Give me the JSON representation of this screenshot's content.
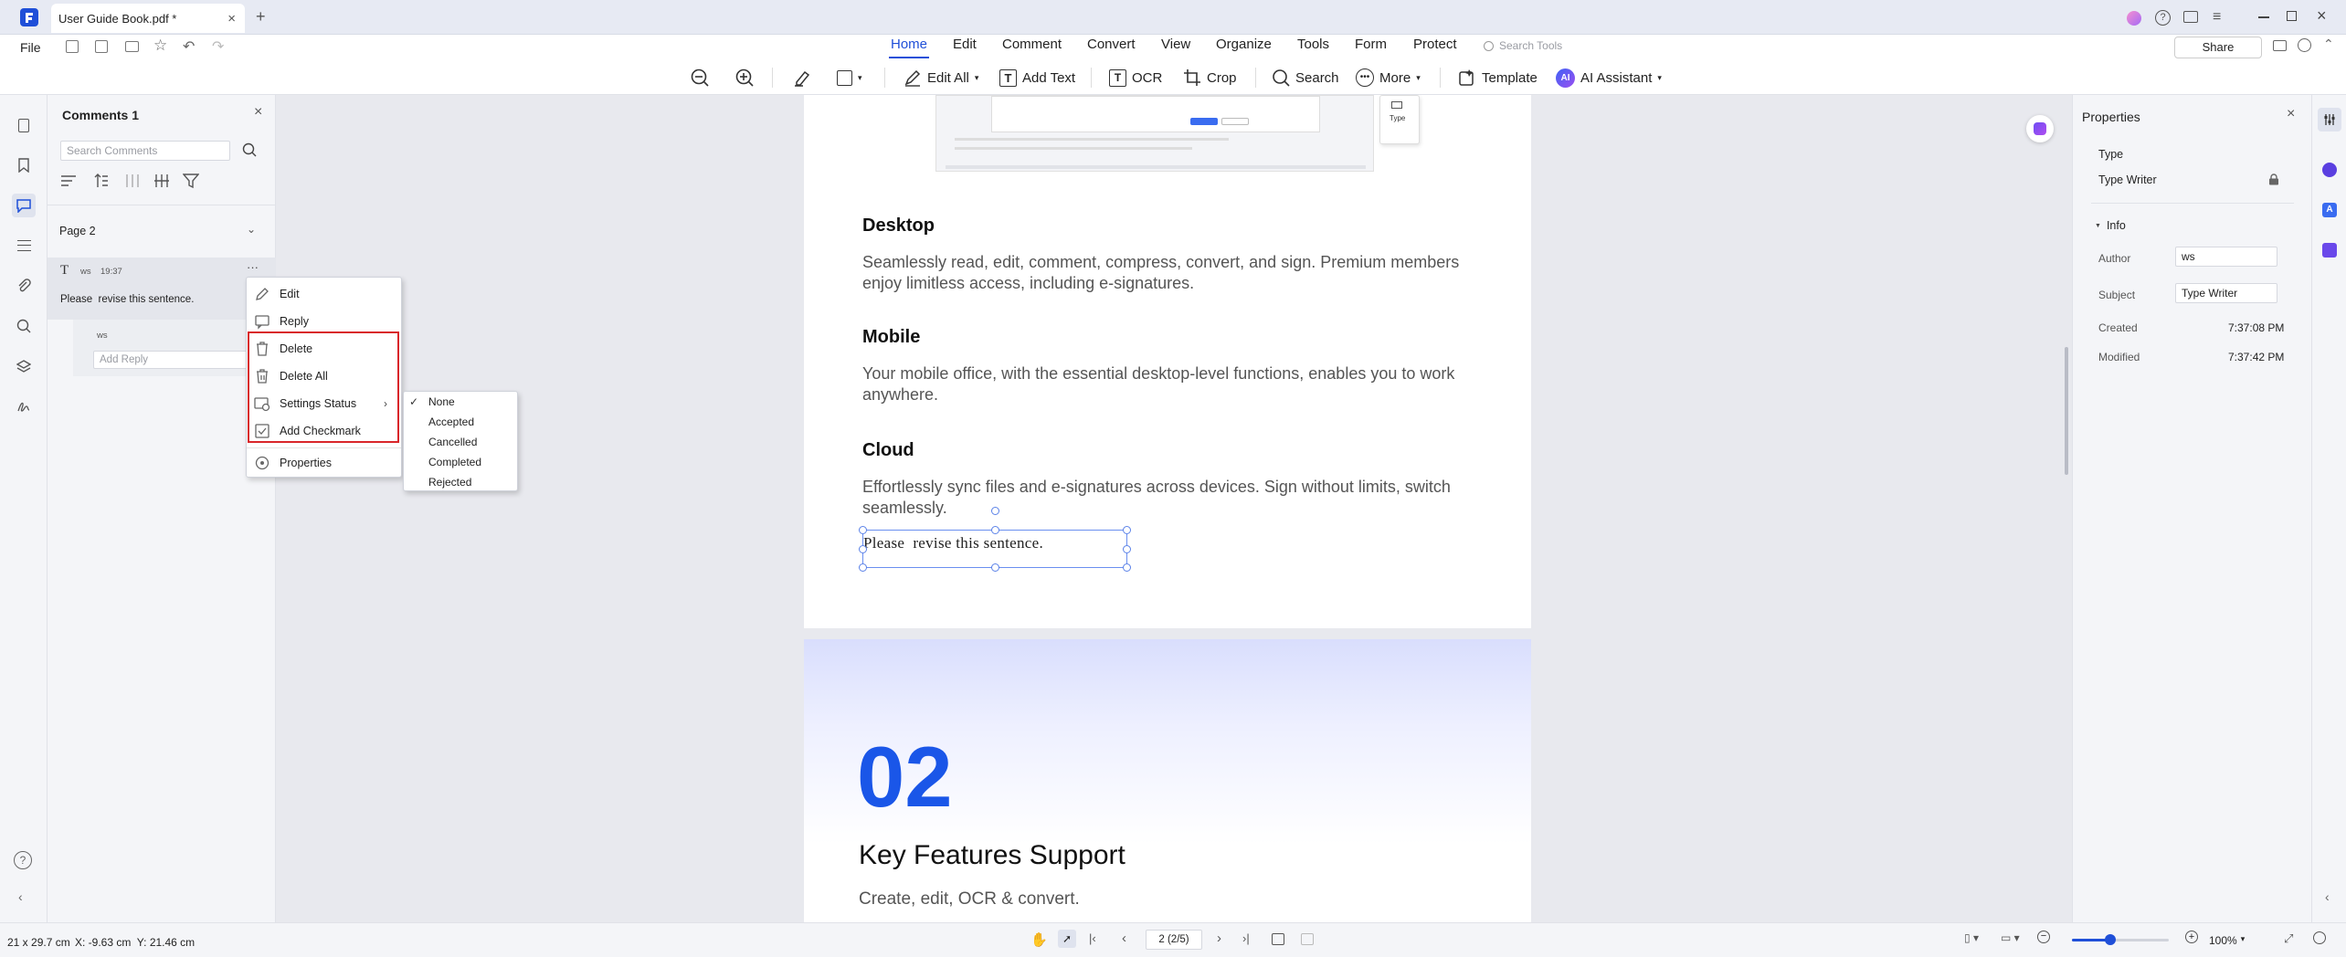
{
  "titlebar": {
    "doc_tab": "User Guide Book.pdf *",
    "new_tab": "+"
  },
  "menubar": {
    "file": "File",
    "tabs": [
      "Home",
      "Edit",
      "Comment",
      "Convert",
      "View",
      "Organize",
      "Tools",
      "Form",
      "Protect"
    ],
    "search_tools_placeholder": "Search Tools",
    "share": "Share",
    "tools": {
      "edit_all": "Edit All",
      "add_text": "Add Text",
      "ocr": "OCR",
      "crop": "Crop",
      "search": "Search",
      "more": "More",
      "template": "Template",
      "ai_assistant": "AI Assistant"
    }
  },
  "comments": {
    "title": "Comments 1",
    "search_placeholder": "Search Comments",
    "page_group": "Page 2",
    "item": {
      "author": "ws",
      "time": "19:37",
      "text": "Please  revise this sentence."
    },
    "reply_author": "ws",
    "reply_placeholder": "Add Reply"
  },
  "context_menu": {
    "items": [
      "Edit",
      "Reply",
      "Delete",
      "Delete All",
      "Settings Status",
      "Add Checkmark",
      "Properties"
    ]
  },
  "status_submenu": {
    "items": [
      "None",
      "Accepted",
      "Cancelled",
      "Completed",
      "Rejected"
    ],
    "checked": "None"
  },
  "document": {
    "mini_dialog_type": "Type",
    "sections": [
      {
        "heading": "Desktop",
        "body": "Seamlessly read, edit, comment, compress, convert, and sign. Premium members enjoy limitless access, including e-signatures."
      },
      {
        "heading": "Mobile",
        "body": "Your mobile office, with the essential desktop-level functions, enables you to work anywhere."
      },
      {
        "heading": "Cloud",
        "body": "Effortlessly sync files and e-signatures across devices. Sign without limits, switch seamlessly."
      }
    ],
    "typewriter_text": "Please  revise this sentence.",
    "next_page": {
      "number": "02",
      "title": "Key Features Support",
      "subtitle": "Create, edit, OCR & convert."
    }
  },
  "properties": {
    "title": "Properties",
    "type_label": "Type",
    "type_value": "Type Writer",
    "info_label": "Info",
    "author_label": "Author",
    "author_value": "ws",
    "subject_label": "Subject",
    "subject_value": "Type Writer",
    "created_label": "Created",
    "created_value": "7:37:08 PM",
    "modified_label": "Modified",
    "modified_value": "7:37:42 PM"
  },
  "statusbar": {
    "page_size": "21 x 29.7 cm",
    "coords": "X: -9.63 cm  Y: 21.46 cm",
    "page_indicator": "2 (2/5)",
    "zoom": "100%",
    "zoom_level": 0.4
  },
  "colors": {
    "accent": "#1f4fd8",
    "highlight_box": "#d9262a",
    "number_blue": "#1a56e8"
  }
}
